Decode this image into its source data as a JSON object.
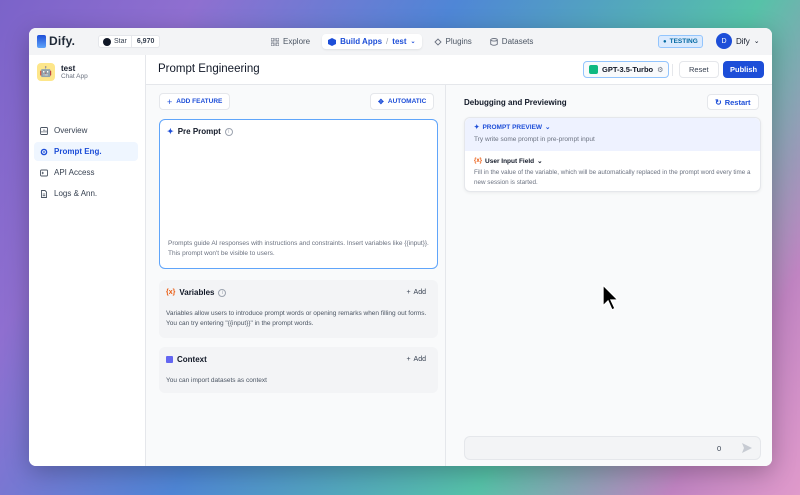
{
  "topbar": {
    "logo_text": "Dify.",
    "github_label": "Star",
    "github_count": "6,970",
    "nav": [
      {
        "label": "Explore"
      },
      {
        "label": "Build Apps",
        "sub": "test"
      },
      {
        "label": "Plugins"
      },
      {
        "label": "Datasets"
      }
    ],
    "env_badge": "TESTING",
    "user_initial": "D",
    "user_name": "Dify"
  },
  "sidebar": {
    "app_name": "test",
    "app_type": "Chat App",
    "items": [
      {
        "label": "Overview"
      },
      {
        "label": "Prompt Eng."
      },
      {
        "label": "API Access"
      },
      {
        "label": "Logs & Ann."
      }
    ]
  },
  "header": {
    "title": "Prompt Engineering",
    "model": "GPT-3.5-Turbo",
    "reset_label": "Reset",
    "publish_label": "Publish"
  },
  "config": {
    "add_feature_label": "ADD FEATURE",
    "automatic_label": "AUTOMATIC",
    "pre_prompt": {
      "title": "Pre Prompt",
      "hint": "Prompts guide AI responses with instructions and constraints. Insert variables like {{input}}. This prompt won't be visible to users."
    },
    "variables": {
      "title": "Variables",
      "add_label": "Add",
      "hint": "Variables allow users to introduce prompt words or opening remarks when filling out forms. You can try entering \"{{input}}\" in the prompt words."
    },
    "context": {
      "title": "Context",
      "add_label": "Add",
      "hint": "You can import datasets as context"
    }
  },
  "debug": {
    "title": "Debugging and Previewing",
    "restart_label": "Restart",
    "prompt_preview_label": "PROMPT PREVIEW",
    "prompt_preview_hint": "Try write some prompt in pre-prompt input",
    "user_input_label": "User Input Field",
    "user_input_hint": "Fill in the value of the variable, which will be automatically replaced in the prompt word every time a new session is started.",
    "char_count": "0"
  },
  "colors": {
    "accent": "#1d4ed8",
    "focus_border": "#60a5fa",
    "model_icon": "#10b981"
  }
}
